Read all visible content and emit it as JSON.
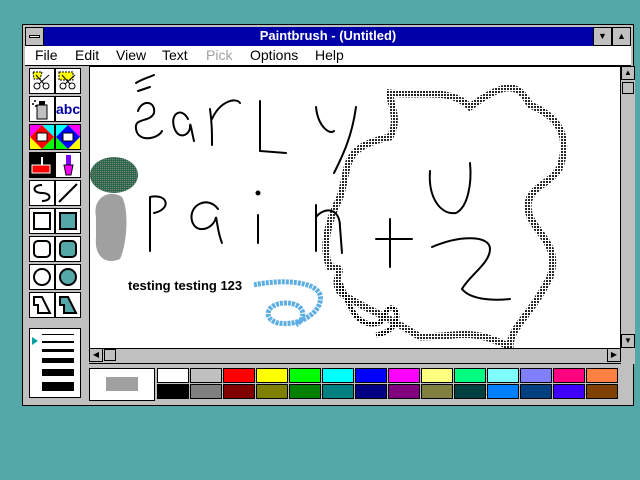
{
  "window": {
    "title": "Paintbrush - (Untitled)",
    "minimize_glyph": "▼",
    "maximize_glyph": "▲"
  },
  "menu": {
    "items": [
      {
        "label": "File"
      },
      {
        "label": "Edit"
      },
      {
        "label": "View"
      },
      {
        "label": "Text"
      },
      {
        "label": "Pick",
        "disabled": true
      },
      {
        "label": "Options"
      },
      {
        "label": "Help"
      }
    ]
  },
  "toolbox": {
    "text_tool_label": "abc",
    "tools": [
      "scissors-icon",
      "pick-scissors-icon",
      "spray-can-icon",
      "text-tool-icon",
      "color-eraser-icon",
      "eraser-icon",
      "paint-roller-icon",
      "brush-icon",
      "curve-icon",
      "line-icon",
      "box-icon",
      "filled-box-icon",
      "rounded-box-icon",
      "filled-rounded-box-icon",
      "circle-icon",
      "filled-circle-icon",
      "polygon-icon",
      "filled-polygon-icon"
    ]
  },
  "canvas": {
    "text_label": "testing testing 123",
    "handwriting": "early paint"
  },
  "scroll": {
    "up": "▲",
    "down": "▼",
    "left": "◀",
    "right": "▶"
  },
  "palette": {
    "foreground": "#a0a0a0",
    "background": "#ffffff",
    "top_row": [
      "#ffffff",
      "#c0c0c0",
      "#ff0000",
      "#ffff00",
      "#00ff00",
      "#00ffff",
      "#0000ff",
      "#ff00ff",
      "#ffff80",
      "#00ff80",
      "#80ffff",
      "#8080ff",
      "#ff0080",
      "#ff8040"
    ],
    "bottom_row": [
      "#000000",
      "#808080",
      "#800000",
      "#808000",
      "#008000",
      "#008080",
      "#000080",
      "#800080",
      "#808040",
      "#004040",
      "#0080ff",
      "#004080",
      "#4000ff",
      "#804000"
    ]
  }
}
